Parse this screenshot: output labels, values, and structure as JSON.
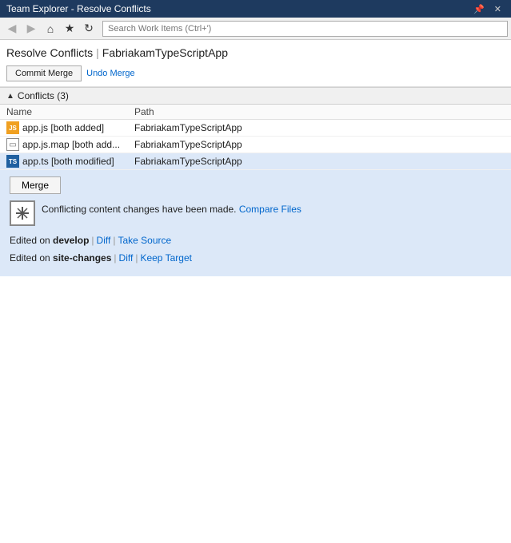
{
  "titlebar": {
    "text": "Team Explorer - Resolve Conflicts",
    "pin_icon": "📌",
    "close_icon": "✕"
  },
  "toolbar": {
    "back_icon": "◀",
    "forward_icon": "▶",
    "home_icon": "⌂",
    "favorites_icon": "★",
    "refresh_icon": "↻",
    "search_placeholder": "Search Work Items (Ctrl+')"
  },
  "header": {
    "title": "Resolve Conflicts",
    "separator": "|",
    "subtitle": "FabriakamTypeScriptApp",
    "commit_merge_label": "Commit Merge",
    "undo_merge_label": "Undo Merge"
  },
  "conflicts_section": {
    "toggle": "▲",
    "label": "Conflicts (3)"
  },
  "table": {
    "headers": {
      "name": "Name",
      "path": "Path"
    },
    "rows": [
      {
        "icon_type": "js",
        "icon_label": "JS",
        "name": "app.js [both added]",
        "path": "FabriakamTypeScriptApp",
        "selected": false
      },
      {
        "icon_type": "generic",
        "icon_label": "",
        "name": "app.js.map [both add...",
        "path": "FabriakamTypeScriptApp",
        "selected": false
      },
      {
        "icon_type": "ts",
        "icon_label": "TS",
        "name": "app.ts [both modified]",
        "path": "FabriakamTypeScriptApp",
        "selected": true
      }
    ]
  },
  "detail_panel": {
    "merge_btn_label": "Merge",
    "conflict_message": "Conflicting content changes have been made.",
    "compare_files_label": "Compare Files",
    "edited_on_label": "Edited on",
    "branch1": {
      "prefix": "Edited on ",
      "branch": "develop",
      "sep1": "|",
      "diff_label": "Diff",
      "sep2": "|",
      "take_label": "Take Source"
    },
    "branch2": {
      "prefix": "Edited on ",
      "branch": "site-changes",
      "sep1": "|",
      "diff_label": "Diff",
      "sep2": "|",
      "take_label": "Keep Target"
    },
    "merge_icon": "⊞"
  }
}
